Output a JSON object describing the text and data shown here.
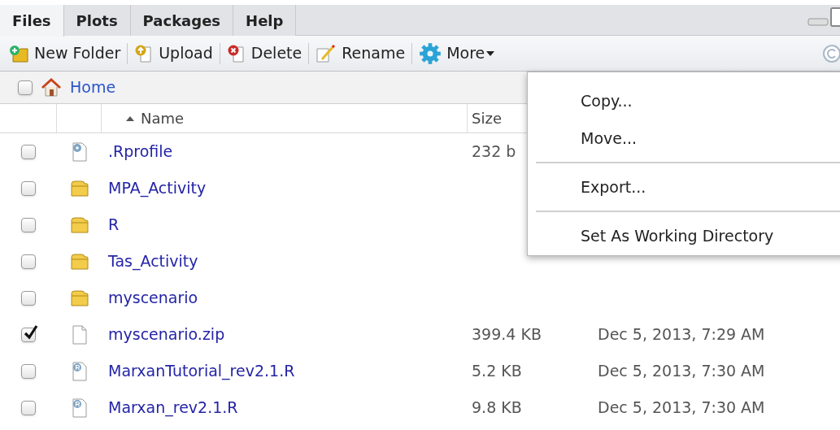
{
  "tabs": [
    {
      "label": "Files",
      "selected": true
    },
    {
      "label": "Plots",
      "selected": false
    },
    {
      "label": "Packages",
      "selected": false
    },
    {
      "label": "Help",
      "selected": false
    }
  ],
  "toolbar": [
    {
      "kind": "new-folder",
      "label": "New Folder"
    },
    {
      "kind": "upload",
      "label": "Upload"
    },
    {
      "kind": "delete",
      "label": "Delete"
    },
    {
      "kind": "rename",
      "label": "Rename"
    },
    {
      "kind": "more",
      "label": "More"
    }
  ],
  "breadcrumb": {
    "checked": false,
    "label": "Home"
  },
  "table": {
    "columns": [
      "Name",
      "Size"
    ],
    "rows": [
      {
        "kind": "settings-file",
        "name": ".Rprofile",
        "size": "232 b",
        "modified": "",
        "checked": false
      },
      {
        "kind": "folder",
        "name": "MPA_Activity",
        "size": "",
        "modified": "",
        "checked": false
      },
      {
        "kind": "folder",
        "name": "R",
        "size": "",
        "modified": "",
        "checked": false
      },
      {
        "kind": "folder",
        "name": "Tas_Activity",
        "size": "",
        "modified": "",
        "checked": false
      },
      {
        "kind": "folder",
        "name": "myscenario",
        "size": "",
        "modified": "",
        "checked": false
      },
      {
        "kind": "file",
        "name": "myscenario.zip",
        "size": "399.4 KB",
        "modified": "Dec 5, 2013, 7:29 AM",
        "checked": true
      },
      {
        "kind": "r-file",
        "name": "MarxanTutorial_rev2.1.R",
        "size": "5.2 KB",
        "modified": "Dec 5, 2013, 7:30 AM",
        "checked": false
      },
      {
        "kind": "r-file",
        "name": "Marxan_rev2.1.R",
        "size": "9.8 KB",
        "modified": "Dec 5, 2013, 7:30 AM",
        "checked": false
      }
    ]
  },
  "menu": {
    "groups": [
      [
        "Copy...",
        "Move..."
      ],
      [
        "Export..."
      ],
      [
        "Set As Working Directory"
      ]
    ]
  }
}
